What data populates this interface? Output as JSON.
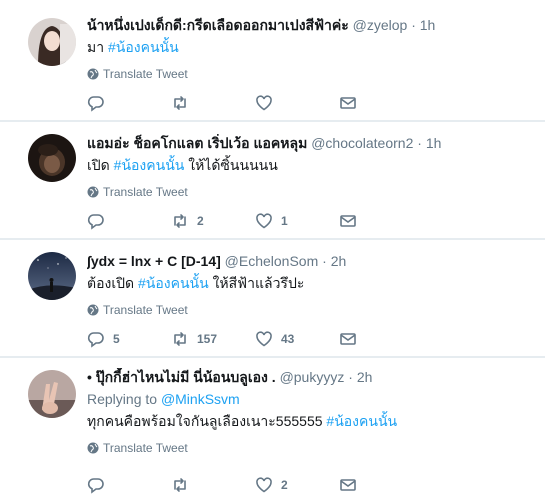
{
  "translate_label": "Translate Tweet",
  "tweets": [
    {
      "name": "น้าหนึ่งเปงเด็กดี:กรีดเลือดออกมาเปงสีฟ้าค่ะ",
      "handle": "@zyelop",
      "dot": "·",
      "time": "1h",
      "text_prefix": "มา ",
      "hashtag": "#น้องคนนั้น",
      "text_suffix": "",
      "reply_count": "",
      "retweet_count": "",
      "like_count": ""
    },
    {
      "name": "แอมอ่ะ ช็อคโกแลต เริ่ปเว้อ แอคหลุม",
      "handle": "@chocolateorn2",
      "dot": "·",
      "time": "1h",
      "text_prefix": "เปิด ",
      "hashtag": "#น้องคนนั้น",
      "text_suffix": " ให้ได้ซิ้นนนนน",
      "reply_count": "",
      "retweet_count": "2",
      "like_count": "1"
    },
    {
      "name": "∫ydx = lnx + C [D-14]",
      "handle": "@EchelonSom",
      "dot": "·",
      "time": "2h",
      "text_prefix": "ต้องเปิด ",
      "hashtag": "#น้องคนนั้น",
      "text_suffix": " ให้สีฟ้าแล้วรึปะ",
      "reply_count": "5",
      "retweet_count": "157",
      "like_count": "43"
    },
    {
      "name": "• ปุ๊กกี้ฮ่าไหนไม่มี นี่น้อนบลูเอง .",
      "handle": "@pukyyyz",
      "dot": "·",
      "time": "2h",
      "reply_to_prefix": "Replying to ",
      "reply_to_user": "@MinkSsvm",
      "text_prefix": "ทุกคนคือพร้อมใจกันลูเลืองเนาะ555555 ",
      "hashtag": "#น้องคนนั้น",
      "text_suffix": "",
      "reply_count": "",
      "retweet_count": "",
      "like_count": "2"
    }
  ],
  "colors": {
    "accent": "#1da1f2",
    "secondary_text": "#657786",
    "background": "#e6ecf0"
  },
  "icons": [
    "reply-icon",
    "retweet-icon",
    "like-icon",
    "direct-message-icon",
    "globe-icon"
  ]
}
